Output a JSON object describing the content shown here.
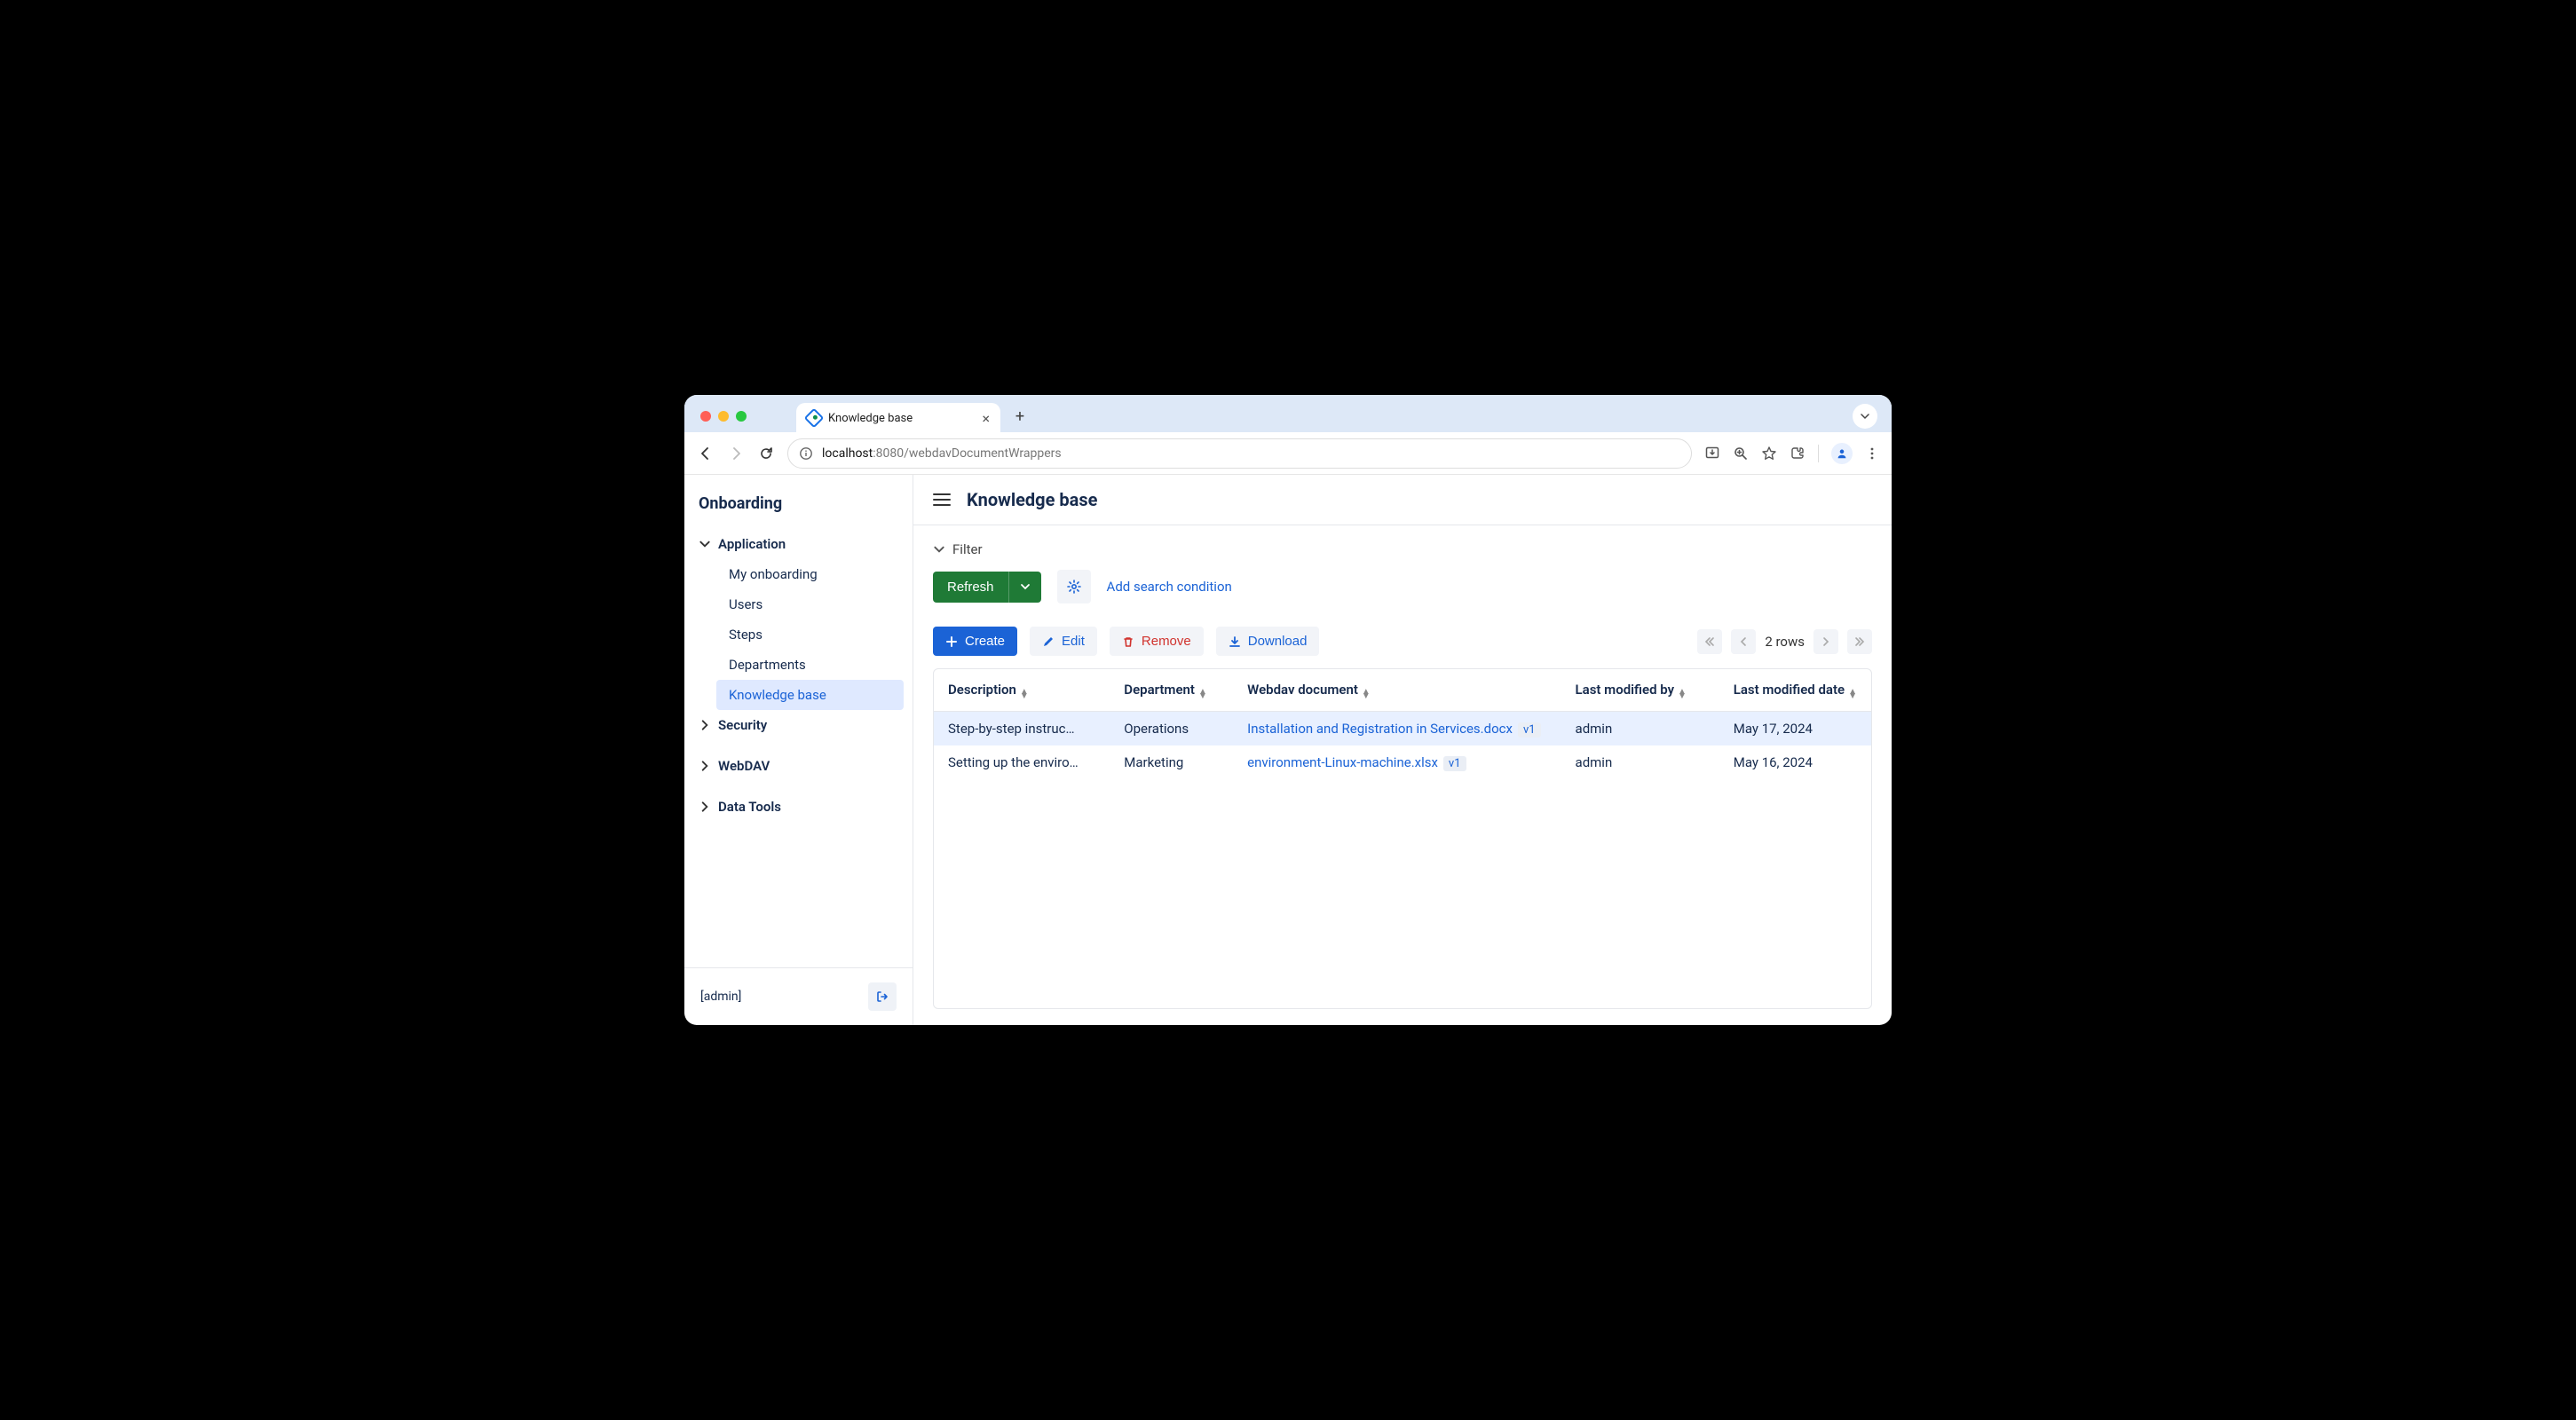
{
  "browser": {
    "tab_title": "Knowledge base",
    "url_host": "localhost",
    "url_port_path": ":8080/webdavDocumentWrappers"
  },
  "sidebar": {
    "title": "Onboarding",
    "groups": [
      {
        "label": "Application",
        "expanded": true,
        "items": [
          {
            "label": "My onboarding"
          },
          {
            "label": "Users"
          },
          {
            "label": "Steps"
          },
          {
            "label": "Departments"
          },
          {
            "label": "Knowledge base",
            "active": true
          }
        ]
      },
      {
        "label": "Security",
        "expanded": false
      },
      {
        "label": "WebDAV",
        "expanded": false
      },
      {
        "label": "Data Tools",
        "expanded": false
      }
    ],
    "footer_user": "[admin]"
  },
  "main": {
    "title": "Knowledge base",
    "filter_label": "Filter",
    "refresh_label": "Refresh",
    "add_condition": "Add search condition",
    "actions": {
      "create": "Create",
      "edit": "Edit",
      "remove": "Remove",
      "download": "Download"
    },
    "rows_count": "2 rows",
    "columns": [
      "Description",
      "Department",
      "Webdav document",
      "Last modified by",
      "Last modified date"
    ],
    "rows": [
      {
        "description": "Step-by-step instruc…",
        "department": "Operations",
        "document": "Installation and Registration in Services.docx",
        "version": "v1",
        "modified_by": "admin",
        "modified_date": "May 17, 2024",
        "selected": true
      },
      {
        "description": "Setting up the enviro…",
        "department": "Marketing",
        "document": "environment-Linux-machine.xlsx",
        "version": "v1",
        "modified_by": "admin",
        "modified_date": "May 16, 2024",
        "selected": false
      }
    ]
  }
}
